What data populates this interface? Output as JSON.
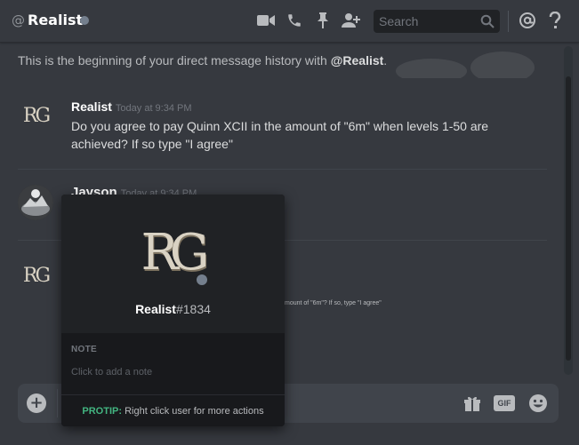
{
  "header": {
    "at_symbol": "@",
    "title": "Realist",
    "search_placeholder": "Search"
  },
  "intro": {
    "prefix": "This is the beginning of your direct message history with",
    "handle": "@Realist",
    "suffix": "."
  },
  "messages": [
    {
      "author": "Realist",
      "timestamp": "Today at 9:34 PM",
      "text": "Do you agree to pay Quinn XCII in the amount of \"6m\" when levels 1-50 are achieved? If so type \"I agree\""
    },
    {
      "author": "Jayson",
      "timestamp": "Today at 9:34 PM"
    },
    {
      "small_text": "mount of \"6m\"? If so, type \"I agree\""
    }
  ],
  "avatar_monogram": "RG",
  "popout": {
    "username": "Realist",
    "discriminator": "#1834",
    "note_label": "NOTE",
    "note_placeholder": "Click to add a note",
    "protip_label": "PROTIP:",
    "protip_text": "Right click user for more actions"
  },
  "composer": {
    "plus": "+",
    "gif_label": "GIF"
  },
  "colors": {
    "background": "#36393f",
    "popout": "#18191c",
    "protip": "#43b581",
    "status_offline": "#747f8d"
  }
}
